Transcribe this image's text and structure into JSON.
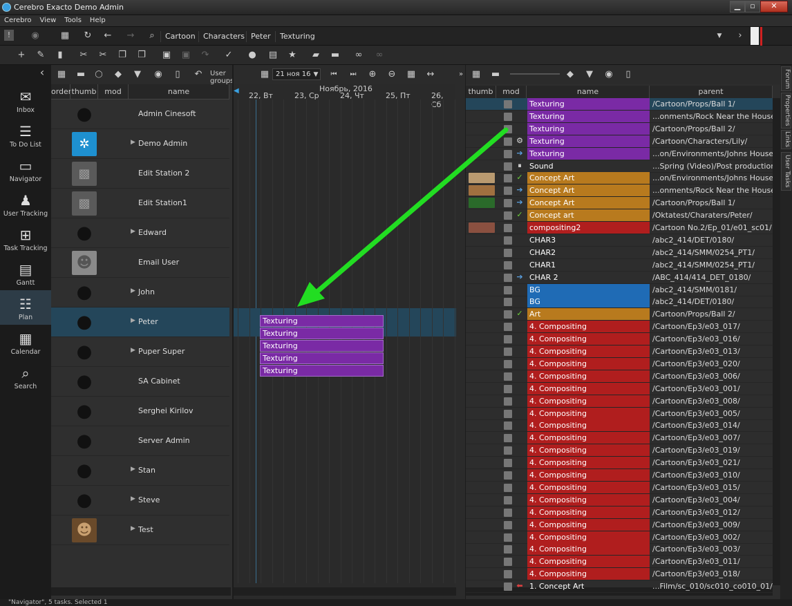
{
  "window": {
    "title": "Cerebro Exacto  Demo Admin"
  },
  "menu": [
    "Cerebro",
    "View",
    "Tools",
    "Help"
  ],
  "breadcrumbs": [
    "Cartoon",
    "Characters",
    "Peter",
    "Texturing"
  ],
  "left_nav": [
    {
      "label": "Inbox",
      "icon": "mail-icon"
    },
    {
      "label": "To Do List",
      "icon": "checklist-icon"
    },
    {
      "label": "Navigator",
      "icon": "folder-icon"
    },
    {
      "label": "User Tracking",
      "icon": "users-icon"
    },
    {
      "label": "Task Tracking",
      "icon": "tree-icon"
    },
    {
      "label": "Gantt",
      "icon": "gantt-icon"
    },
    {
      "label": "Plan",
      "icon": "list-icon",
      "selected": true
    },
    {
      "label": "Calendar",
      "icon": "calendar-icon"
    },
    {
      "label": "Search",
      "icon": "search-icon"
    }
  ],
  "user_toolbar": {
    "user_groups": "User groups",
    "date": "21 ноя 16"
  },
  "user_columns": [
    "order",
    "thumb",
    "mod",
    "name"
  ],
  "users": [
    {
      "name": "Admin Cinesoft",
      "expand": false,
      "avatar": "silhouette"
    },
    {
      "name": "Demo Admin",
      "expand": true,
      "avatar": "logo"
    },
    {
      "name": "Edit Station 2",
      "expand": false,
      "avatar": "box"
    },
    {
      "name": "Edit Station1",
      "expand": false,
      "avatar": "box"
    },
    {
      "name": "Edward",
      "expand": true,
      "avatar": "silhouette"
    },
    {
      "name": "Email User",
      "expand": false,
      "avatar": "photo-gray"
    },
    {
      "name": "John",
      "expand": true,
      "avatar": "silhouette"
    },
    {
      "name": "Peter",
      "expand": true,
      "avatar": "silhouette",
      "selected": true
    },
    {
      "name": "Puper Super",
      "expand": true,
      "avatar": "silhouette"
    },
    {
      "name": "SA Cabinet",
      "expand": false,
      "avatar": "silhouette"
    },
    {
      "name": "Serghei Kirilov",
      "expand": false,
      "avatar": "silhouette"
    },
    {
      "name": "Server Admin",
      "expand": false,
      "avatar": "silhouette"
    },
    {
      "name": "Stan",
      "expand": true,
      "avatar": "silhouette"
    },
    {
      "name": "Steve",
      "expand": true,
      "avatar": "silhouette"
    },
    {
      "name": "Test",
      "expand": true,
      "avatar": "photo-color"
    }
  ],
  "gantt": {
    "month": "Ноябрь, 2016",
    "days": [
      "22, Вт",
      "23, Ср",
      "24, Чт",
      "25, Пт",
      "26, Сб"
    ],
    "bars": [
      "Texturing",
      "Texturing",
      "Texturing",
      "Texturing",
      "Texturing"
    ]
  },
  "task_columns": [
    "thumb",
    "mod",
    "name",
    "parent"
  ],
  "tasks": [
    {
      "name": "Texturing",
      "parent": "/Cartoon/Props/Ball 1/",
      "color": "#7a2aa5",
      "status": "",
      "selected": true
    },
    {
      "name": "Texturing",
      "parent": "...onments/Rock Near the House/",
      "color": "#7a2aa5",
      "status": ""
    },
    {
      "name": "Texturing",
      "parent": "/Cartoon/Props/Ball 2/",
      "color": "#7a2aa5",
      "status": ""
    },
    {
      "name": "Texturing",
      "parent": "/Cartoon/Characters/Lily/",
      "color": "#7a2aa5",
      "status": "gear"
    },
    {
      "name": "Texturing",
      "parent": "...on/Environments/Johns House/",
      "color": "#7a2aa5",
      "status": "arrow"
    },
    {
      "name": "Sound",
      "parent": "...Spring (Video)/Post production/",
      "color": "",
      "status": "pause"
    },
    {
      "name": "Concept Art",
      "parent": "...on/Environments/Johns House/",
      "color": "#b87a1e",
      "status": "check",
      "thumb": "#b99a70"
    },
    {
      "name": "Concept Art",
      "parent": "...onments/Rock Near the House/",
      "color": "#b87a1e",
      "status": "arrow",
      "thumb": "#a07040"
    },
    {
      "name": "Concept Art",
      "parent": "/Cartoon/Props/Ball 1/",
      "color": "#b87a1e",
      "status": "arrow",
      "thumb": "#2a6a2a"
    },
    {
      "name": "Concept art",
      "parent": "/Oktatest/Charaters/Peter/",
      "color": "#b87a1e",
      "status": "check"
    },
    {
      "name": "compositing2",
      "parent": "/Cartoon No.2/Ep_01/e01_sc01/",
      "color": "#b01e1e",
      "status": "",
      "thumb": "#8a5040"
    },
    {
      "name": "CHAR3",
      "parent": "/abc2_414/DET/0180/",
      "color": "",
      "status": ""
    },
    {
      "name": "CHAR2",
      "parent": "/abc2_414/SMM/0254_PT1/",
      "color": "",
      "status": ""
    },
    {
      "name": "CHAR1",
      "parent": "/abc2_414/SMM/0254_PT1/",
      "color": "",
      "status": ""
    },
    {
      "name": "CHAR 2",
      "parent": "/ABC_414/414_DET_0180/",
      "color": "",
      "status": "arrow"
    },
    {
      "name": "BG",
      "parent": "/abc2_414/SMM/0181/",
      "color": "#1f6bb5",
      "status": ""
    },
    {
      "name": "BG",
      "parent": "/abc2_414/DET/0180/",
      "color": "#1f6bb5",
      "status": ""
    },
    {
      "name": "Art",
      "parent": "/Cartoon/Props/Ball 2/",
      "color": "#b87a1e",
      "status": "check"
    },
    {
      "name": "4. Compositing",
      "parent": "/Cartoon/Ep3/e03_017/",
      "color": "#b01e1e",
      "status": ""
    },
    {
      "name": "4. Compositing",
      "parent": "/Cartoon/Ep3/e03_016/",
      "color": "#b01e1e",
      "status": ""
    },
    {
      "name": "4. Compositing",
      "parent": "/Cartoon/Ep3/e03_013/",
      "color": "#b01e1e",
      "status": ""
    },
    {
      "name": "4. Compositing",
      "parent": "/Cartoon/Ep3/e03_020/",
      "color": "#b01e1e",
      "status": ""
    },
    {
      "name": "4. Compositing",
      "parent": "/Cartoon/Ep3/e03_006/",
      "color": "#b01e1e",
      "status": ""
    },
    {
      "name": "4. Compositing",
      "parent": "/Cartoon/Ep3/e03_001/",
      "color": "#b01e1e",
      "status": ""
    },
    {
      "name": "4. Compositing",
      "parent": "/Cartoon/Ep3/e03_008/",
      "color": "#b01e1e",
      "status": ""
    },
    {
      "name": "4. Compositing",
      "parent": "/Cartoon/Ep3/e03_005/",
      "color": "#b01e1e",
      "status": ""
    },
    {
      "name": "4. Compositing",
      "parent": "/Cartoon/Ep3/e03_014/",
      "color": "#b01e1e",
      "status": ""
    },
    {
      "name": "4. Compositing",
      "parent": "/Cartoon/Ep3/e03_007/",
      "color": "#b01e1e",
      "status": ""
    },
    {
      "name": "4. Compositing",
      "parent": "/Cartoon/Ep3/e03_019/",
      "color": "#b01e1e",
      "status": ""
    },
    {
      "name": "4. Compositing",
      "parent": "/Cartoon/Ep3/e03_021/",
      "color": "#b01e1e",
      "status": ""
    },
    {
      "name": "4. Compositing",
      "parent": "/Cartoon/Ep3/e03_010/",
      "color": "#b01e1e",
      "status": ""
    },
    {
      "name": "4. Compositing",
      "parent": "/Cartoon/Ep3/e03_015/",
      "color": "#b01e1e",
      "status": ""
    },
    {
      "name": "4. Compositing",
      "parent": "/Cartoon/Ep3/e03_004/",
      "color": "#b01e1e",
      "status": ""
    },
    {
      "name": "4. Compositing",
      "parent": "/Cartoon/Ep3/e03_012/",
      "color": "#b01e1e",
      "status": ""
    },
    {
      "name": "4. Compositing",
      "parent": "/Cartoon/Ep3/e03_009/",
      "color": "#b01e1e",
      "status": ""
    },
    {
      "name": "4. Compositing",
      "parent": "/Cartoon/Ep3/e03_002/",
      "color": "#b01e1e",
      "status": ""
    },
    {
      "name": "4. Compositing",
      "parent": "/Cartoon/Ep3/e03_003/",
      "color": "#b01e1e",
      "status": ""
    },
    {
      "name": "4. Compositing",
      "parent": "/Cartoon/Ep3/e03_011/",
      "color": "#b01e1e",
      "status": ""
    },
    {
      "name": "4. Compositing",
      "parent": "/Cartoon/Ep3/e03_018/",
      "color": "#b01e1e",
      "status": ""
    },
    {
      "name": "1. Concept Art",
      "parent": "...Film/sc_010/sc010_co010_01/",
      "color": "",
      "status": "arrow-red"
    }
  ],
  "right_tabs": [
    "Forum",
    "Properties",
    "Links",
    "User Tasks"
  ],
  "status": "\"Navigator\", 5 tasks. Selected 1"
}
